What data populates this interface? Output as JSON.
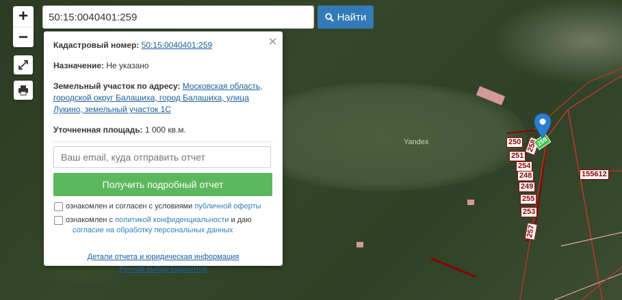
{
  "search": {
    "value": "50:15:0040401:259",
    "button_label": "Найти"
  },
  "map": {
    "watermark": "Yandex",
    "parcel_labels": [
      "250",
      "258",
      "251",
      "254",
      "248",
      "249",
      "255",
      "253",
      "257",
      "155612",
      "259"
    ],
    "marker_color": "#2b7fd0"
  },
  "popup": {
    "cadastral_label": "Кадастровый номер:",
    "cadastral_value": "50:15:0040401:259",
    "purpose_label": "Назначение:",
    "purpose_value": "Не указано",
    "address_label": "Земельный участок по адресу:",
    "address_value": "Московская область, городской округ Балашиха, город Балашиха, улица Лукино, земельный участок 1С",
    "area_label": "Уточненная площадь:",
    "area_value": "1 000",
    "area_unit": "кв.м.",
    "email_placeholder": "Ваш email, куда отправить отчет",
    "report_button": "Получить подробный отчет",
    "consent1_pre": "ознакомлен и согласен с условиями",
    "consent1_link": "публичной оферты",
    "consent2_pre": "ознакомлен с",
    "consent2_link": "политикой конфиденциальности",
    "consent2_mid": "и даю",
    "consent2_link2": "согласие на обработку персональных данных",
    "details_link": "Детали отчета и юридическая информация",
    "manual_link": "Ручной выбор вариантов"
  },
  "colors": {
    "accent": "#337ab7",
    "green_button": "#5cb85c",
    "parcel_border": "#8b0000"
  }
}
